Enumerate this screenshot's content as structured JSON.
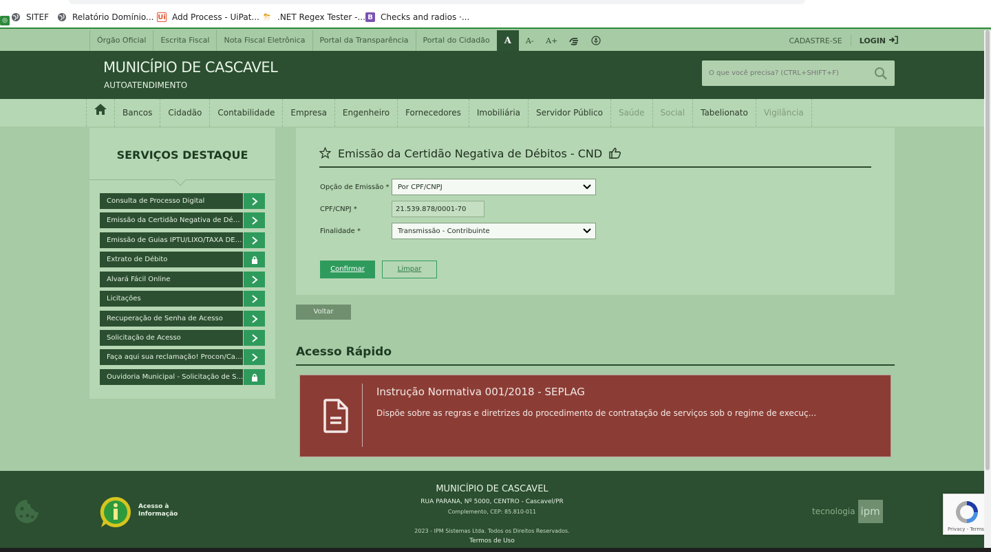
{
  "browser": {
    "bookmarks": [
      {
        "label": "SITEF",
        "icon": "globe-icon"
      },
      {
        "label": "Relatório Domínio...",
        "icon": "globe-icon"
      },
      {
        "label": "Add Process - UiPat...",
        "icon": "uipath-icon"
      },
      {
        "label": ".NET Regex Tester -...",
        "icon": "storm-icon"
      },
      {
        "label": "Checks and radios ·...",
        "icon": "bootstrap-icon"
      }
    ]
  },
  "topnav": {
    "links": [
      "Órgão Oficial",
      "Escrita Fiscal",
      "Nota Fiscal Eletrônica",
      "Portal da Transparência",
      "Portal do Cidadão"
    ],
    "font_normal": "A",
    "font_smaller": "A-",
    "font_larger": "A+",
    "register": "CADASTRE-SE",
    "login": "LOGIN"
  },
  "header": {
    "title": "MUNICÍPIO DE CASCAVEL",
    "subtitle": "AUTOATENDIMENTO",
    "search_placeholder": "O que você precisa? (CTRL+SHIFT+F)"
  },
  "mainnav": {
    "items": [
      {
        "label": "Bancos",
        "enabled": true
      },
      {
        "label": "Cidadão",
        "enabled": true
      },
      {
        "label": "Contabilidade",
        "enabled": true
      },
      {
        "label": "Empresa",
        "enabled": true
      },
      {
        "label": "Engenheiro",
        "enabled": true
      },
      {
        "label": "Fornecedores",
        "enabled": true
      },
      {
        "label": "Imobiliária",
        "enabled": true
      },
      {
        "label": "Servidor Público",
        "enabled": true
      },
      {
        "label": "Saúde",
        "enabled": false
      },
      {
        "label": "Social",
        "enabled": false
      },
      {
        "label": "Tabelionato",
        "enabled": true
      },
      {
        "label": "Vigilância",
        "enabled": false
      }
    ]
  },
  "sidebar": {
    "title": "SERVIÇOS DESTAQUE",
    "items": [
      {
        "label": "Consulta de Processo Digital",
        "action": "arrow"
      },
      {
        "label": "Emissão da Certidão Negativa de Débi...",
        "action": "arrow"
      },
      {
        "label": "Emissão de Guias IPTU/LIXO/TAXA DE ...",
        "action": "arrow"
      },
      {
        "label": "Extrato de Débito",
        "action": "lock"
      },
      {
        "label": "Alvará Fácil Online",
        "action": "arrow"
      },
      {
        "label": "Licitações",
        "action": "arrow"
      },
      {
        "label": "Recuperação de Senha de Acesso",
        "action": "arrow"
      },
      {
        "label": "Solicitação de Acesso",
        "action": "arrow"
      },
      {
        "label": "Faça aqui sua reclamação! Procon/Cas...",
        "action": "arrow"
      },
      {
        "label": "Ouvidoria Municipal - Solicitação de S...",
        "action": "lock"
      }
    ]
  },
  "form": {
    "title": "Emissão da Certidão Negativa de Débitos - CND",
    "emission_label": "Opção de Emissão *",
    "emission_value": "Por CPF/CNPJ",
    "cpf_label": "CPF/CNPJ *",
    "cpf_value": "21.539.878/0001-70",
    "purpose_label": "Finalidade *",
    "purpose_value": "Transmissão - Contribuinte",
    "confirm": "Confirmar",
    "clear": "Limpar",
    "back": "Voltar"
  },
  "quick_access": {
    "title": "Acesso Rápido",
    "card_title": "Instrução Normativa 001/2018 - SEPLAG",
    "card_desc": "Dispõe sobre as regras e diretrizes do procedimento de contratação de serviços sob o regime de execuç..."
  },
  "footer": {
    "title": "MUNICÍPIO DE CASCAVEL",
    "address": "RUA PARANA, Nº 5000, CENTRO - Cascavel/PR",
    "complement": "Complemento, CEP: 85.810-011",
    "copyright": "2023 - IPM Sistemas Ltda. Todos os Direitos Reservados.",
    "terms": "Termos de Uso",
    "info_line1": "Acesso à",
    "info_line2": "Informação",
    "tech": "tecnologia",
    "ipm": "ipm",
    "recaptcha": "Privacy - Terms"
  },
  "colors": {
    "header_bg": "#2b4f30",
    "nav_bg": "#b6d7b3",
    "accent": "#2e9b5c",
    "notice_bg": "#8b3d35"
  }
}
